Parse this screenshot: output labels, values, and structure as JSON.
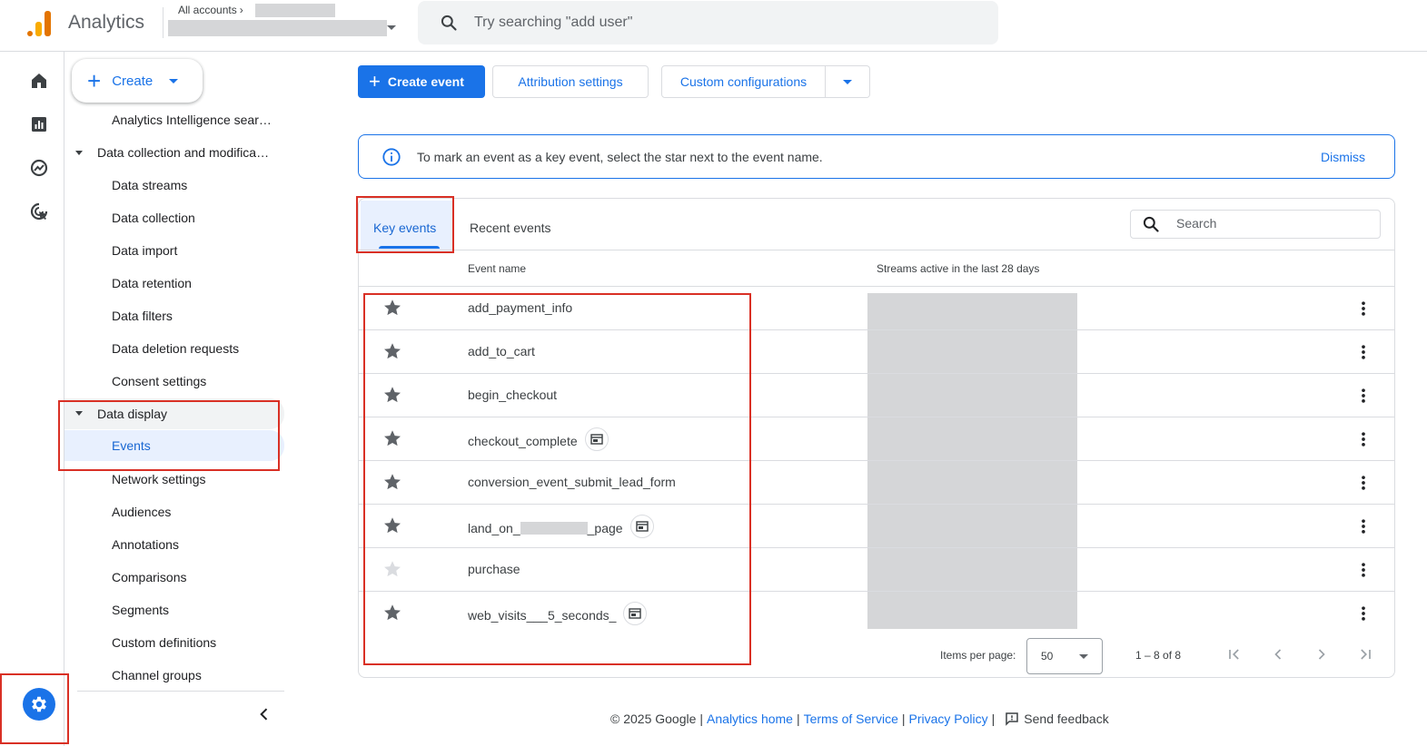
{
  "app": {
    "name": "Analytics",
    "accounts_label": "All accounts",
    "search_placeholder": "Try searching \"add user\""
  },
  "nav": {
    "create_label": "Create",
    "items": [
      {
        "label": "Analytics Intelligence sear…",
        "type": "child"
      },
      {
        "label": "Data collection and modifica…",
        "type": "group"
      },
      {
        "label": "Data streams",
        "type": "child"
      },
      {
        "label": "Data collection",
        "type": "child"
      },
      {
        "label": "Data import",
        "type": "child"
      },
      {
        "label": "Data retention",
        "type": "child"
      },
      {
        "label": "Data filters",
        "type": "child"
      },
      {
        "label": "Data deletion requests",
        "type": "child"
      },
      {
        "label": "Consent settings",
        "type": "child"
      },
      {
        "label": "Data display",
        "type": "group"
      },
      {
        "label": "Events",
        "type": "child",
        "active": true
      },
      {
        "label": "Network settings",
        "type": "child"
      },
      {
        "label": "Audiences",
        "type": "child"
      },
      {
        "label": "Annotations",
        "type": "child"
      },
      {
        "label": "Comparisons",
        "type": "child"
      },
      {
        "label": "Segments",
        "type": "child"
      },
      {
        "label": "Custom definitions",
        "type": "child"
      },
      {
        "label": "Channel groups",
        "type": "child"
      }
    ]
  },
  "toolbar": {
    "create_event": "Create event",
    "attribution_settings": "Attribution settings",
    "custom_configurations": "Custom configurations"
  },
  "banner": {
    "message": "To mark an event as a key event, select the star next to the event name.",
    "dismiss": "Dismiss"
  },
  "tabs": {
    "key_events": "Key events",
    "recent_events": "Recent events"
  },
  "table": {
    "search_placeholder": "Search",
    "col_event_name": "Event name",
    "col_streams": "Streams active in the last 28 days",
    "rows": [
      {
        "name": "add_payment_info",
        "starred": true,
        "badge": false
      },
      {
        "name": "add_to_cart",
        "starred": true,
        "badge": false
      },
      {
        "name": "begin_checkout",
        "starred": true,
        "badge": false
      },
      {
        "name": "checkout_complete",
        "starred": true,
        "badge": true
      },
      {
        "name": "conversion_event_submit_lead_form",
        "starred": true,
        "badge": false
      },
      {
        "name_prefix": "land_on_",
        "name_suffix": "_page",
        "starred": true,
        "badge": true
      },
      {
        "name": "purchase",
        "starred": false,
        "badge": false
      },
      {
        "name": "web_visits___5_seconds_",
        "starred": true,
        "badge": true
      }
    ]
  },
  "pager": {
    "items_per_page_label": "Items per page:",
    "items_per_page_value": "50",
    "range": "1 – 8 of 8"
  },
  "footer": {
    "copyright": "© 2025 Google",
    "analytics_home": "Analytics home",
    "terms": "Terms of Service",
    "privacy": "Privacy Policy",
    "feedback": "Send feedback"
  },
  "colors": {
    "accent": "#1a73e8",
    "star_on": "#5f6368",
    "star_off": "#dadce0",
    "highlight": "#d93025"
  }
}
